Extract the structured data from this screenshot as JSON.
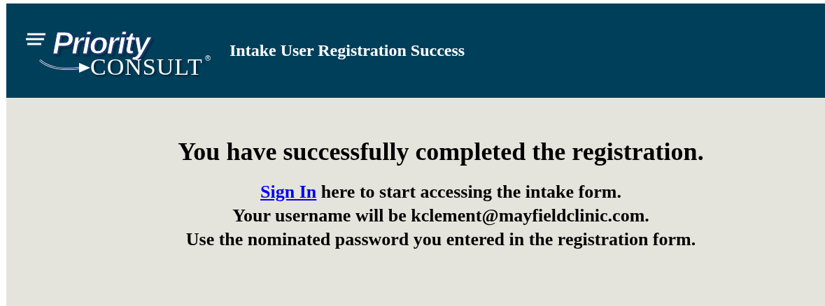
{
  "header": {
    "logo": {
      "word": "Priority",
      "brand": "CONSULT",
      "mark": "®"
    },
    "title": "Intake User Registration Success"
  },
  "message": {
    "heading": "You have successfully completed the registration.",
    "signin": {
      "link": "Sign In",
      "text": " here to start accessing the intake form."
    },
    "lines": [
      "Your username will be kclement@mayfieldclinic.com.",
      "Use the nominated password you entered in the registration form."
    ]
  }
}
